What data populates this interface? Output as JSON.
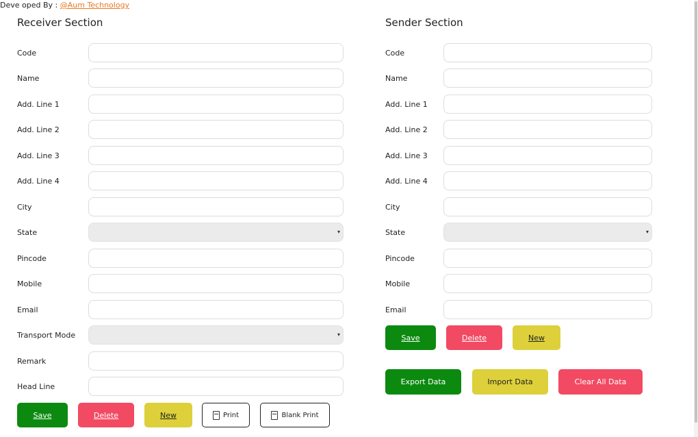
{
  "credit": {
    "prefix": "Deve oped By : ",
    "link": "@Aum Technology"
  },
  "receiver": {
    "title": "Receiver Section",
    "labels": {
      "code": "Code",
      "name": "Name",
      "add1": "Add. Line 1",
      "add2": "Add. Line 2",
      "add3": "Add. Line 3",
      "add4": "Add. Line 4",
      "city": "City",
      "state": "State",
      "pincode": "Pincode",
      "mobile": "Mobile",
      "email": "Email",
      "transport": "Transport Mode",
      "remark": "Remark",
      "headline": "Head Line"
    },
    "buttons": {
      "save": "Save",
      "delete": "Delete",
      "new": "New",
      "print": "Print",
      "blank_print": "Blank Print"
    }
  },
  "sender": {
    "title": "Sender Section",
    "labels": {
      "code": "Code",
      "name": "Name",
      "add1": "Add. Line 1",
      "add2": "Add. Line 2",
      "add3": "Add. Line 3",
      "add4": "Add. Line 4",
      "city": "City",
      "state": "State",
      "pincode": "Pincode",
      "mobile": "Mobile",
      "email": "Email"
    },
    "buttons": {
      "save": "Save",
      "delete": "Delete",
      "new": "New",
      "export": "Export Data",
      "import": "Import Data",
      "clear": "Clear All Data"
    }
  },
  "colors": {
    "save": "#0c8a10",
    "delete": "#f24a63",
    "new": "#ddd03a",
    "link": "#e87722"
  },
  "icons": {
    "print": "document-icon",
    "caret": "chevron-down-icon"
  }
}
